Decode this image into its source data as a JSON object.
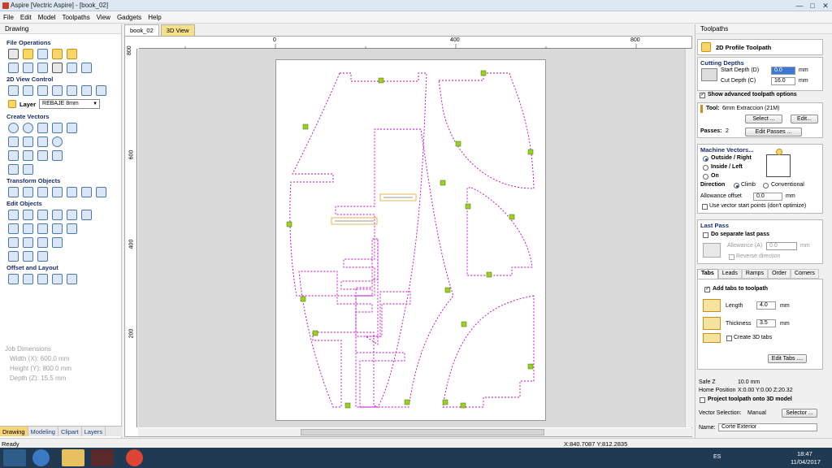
{
  "window": {
    "title": "Aspire [Vectric Aspire] - [book_02]",
    "controls": [
      "—",
      "□",
      "✕"
    ]
  },
  "menu": [
    "File",
    "Edit",
    "Model",
    "Toolpaths",
    "View",
    "Gadgets",
    "Help"
  ],
  "left_panel": {
    "header": "Drawing",
    "sections": {
      "file_operations": "File Operations",
      "view_control": "2D View Control",
      "create_vectors": "Create Vectors",
      "transform_objects": "Transform Objects",
      "edit_objects": "Edit Objects",
      "offset_layout": "Offset and Layout"
    },
    "layer_label": "Layer",
    "layer_value": "REBAJE 8mm",
    "job_dimensions": {
      "title": "Job Dimensions",
      "width": "Width  (X): 600.0 mm",
      "height": "Height (Y): 800.0 mm",
      "depth": "Depth  (Z): 15.5 mm"
    },
    "tabs": [
      "Drawing",
      "Modeling",
      "Clipart",
      "Layers"
    ]
  },
  "document_tabs": [
    "book_02",
    "3D View"
  ],
  "ruler": {
    "h_labels": [
      "0",
      "400",
      "800"
    ],
    "v_labels": [
      "800",
      "600",
      "400",
      "200"
    ]
  },
  "right_panel": {
    "header": "Toolpaths",
    "toolpath_title": "2D Profile Toolpath",
    "cutting_depths": "Cutting Depths",
    "start_depth_label": "Start Depth (D)",
    "start_depth_value": "0.0",
    "cut_depth_label": "Cut Depth (C)",
    "cut_depth_value": "16.0",
    "unit": "mm",
    "show_advanced": "Show advanced toolpath options",
    "tool_label": "Tool:",
    "tool_value": "6mm Extraccion (21M)",
    "select_button": "Select ...",
    "edit_button": "Edit...",
    "passes_label": "Passes:",
    "passes_value": "2",
    "edit_passes_button": "Edit Passes ...",
    "machine_vectors": "Machine Vectors...",
    "outside_right": "Outside / Right",
    "inside_left": "Inside / Left",
    "on": "On",
    "direction_label": "Direction",
    "climb": "Climb",
    "conventional": "Conventional",
    "allowance_label": "Allowance offset",
    "allowance_value": "0.0",
    "use_vector_start": "Use vector start points (don't optimize)",
    "last_pass": "Last Pass",
    "separate_last_pass": "Do separate last pass",
    "allowance_a_label": "Allowance (A)",
    "allowance_a_value": "0.0",
    "reverse_direction": "Reverse direction",
    "subtabs": [
      "Tabs",
      "Leads",
      "Ramps",
      "Order",
      "Corners"
    ],
    "add_tabs": "Add tabs to toolpath",
    "length_label": "Length",
    "length_value": "4.0",
    "thickness_label": "Thickness",
    "thickness_value": "3.5",
    "create_3d_tabs": "Create 3D tabs",
    "edit_tabs_button": "Edit Tabs ....",
    "safe_z_label": "Safe Z",
    "safe_z_value": "10.0 mm",
    "home_label": "Home Position",
    "home_value": "X:0.00 Y:0.00 Z:20.32",
    "project_toolpath": "Project toolpath onto 3D model",
    "vector_selection_label": "Vector Selection:",
    "vector_selection_value": "Manual",
    "selector_button": "Selector ...",
    "name_label": "Name:",
    "name_value": "Corte Exterior"
  },
  "status": {
    "left": "Ready",
    "coords": "X:840.7087 Y:812.2835"
  },
  "taskbar": {
    "lang": "ES",
    "time": "18:47",
    "date": "11/04/2017"
  },
  "colors": {
    "vector_path": "#c000c0",
    "tab_marker": "#9ad020",
    "accent_tab": "#f8d47a"
  }
}
